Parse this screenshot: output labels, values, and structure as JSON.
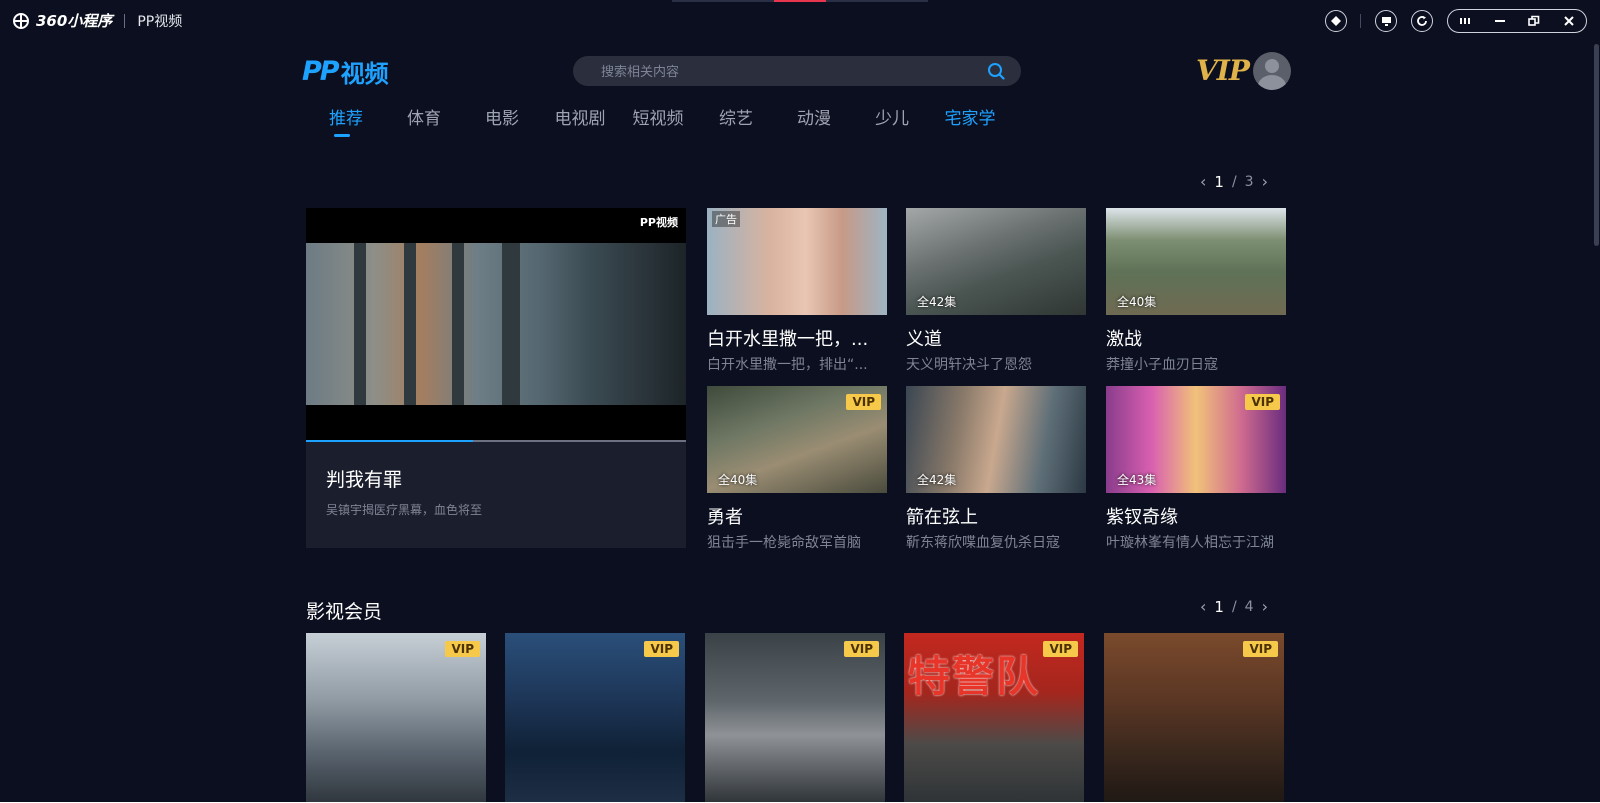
{
  "titlebar": {
    "brand": "360小程序",
    "app_name": "PP视频"
  },
  "header": {
    "logo_mark": "PP",
    "logo_text": "视频",
    "search_placeholder": "搜索相关内容",
    "vip_label": "VIP"
  },
  "nav": {
    "tabs": [
      {
        "label": "推荐"
      },
      {
        "label": "体育"
      },
      {
        "label": "电影"
      },
      {
        "label": "电视剧"
      },
      {
        "label": "短视频"
      },
      {
        "label": "综艺"
      },
      {
        "label": "动漫"
      },
      {
        "label": "少儿"
      },
      {
        "label": "宅家学"
      }
    ],
    "active_index": 0
  },
  "top_pager": {
    "current": "1",
    "separator": "/",
    "total": "3"
  },
  "featured": {
    "watermark": "PP视频",
    "title": "判我有罪",
    "desc": "吴镇宇揭医疗黑幕，血色将至",
    "progress": 0.44
  },
  "grid_cards": [
    {
      "title": "白开水里撒一把，...",
      "desc": "白开水里撒一把，排出“...",
      "badge_ad": "广告",
      "episodes": "",
      "vip": ""
    },
    {
      "title": "义道",
      "desc": "天义明轩决斗了恩怨",
      "badge_ad": "",
      "episodes": "全42集",
      "vip": ""
    },
    {
      "title": "激战",
      "desc": "莽撞小子血刃日寇",
      "badge_ad": "",
      "episodes": "全40集",
      "vip": ""
    },
    {
      "title": "勇者",
      "desc": "狙击手一枪毙命敌军首脑",
      "badge_ad": "",
      "episodes": "全40集",
      "vip": "VIP"
    },
    {
      "title": "箭在弦上",
      "desc": "靳东蒋欣喋血复仇杀日寇",
      "badge_ad": "",
      "episodes": "全42集",
      "vip": ""
    },
    {
      "title": "紫钗奇缘",
      "desc": "叶璇林峯有情人相忘于江湖",
      "badge_ad": "",
      "episodes": "全43集",
      "vip": "VIP"
    }
  ],
  "member_section": {
    "title": "影视会员",
    "pager": {
      "current": "1",
      "separator": "/",
      "total": "4"
    },
    "posters": [
      {
        "vip": "VIP"
      },
      {
        "vip": "VIP"
      },
      {
        "vip": "VIP"
      },
      {
        "vip": "VIP",
        "poster_text": "特警队"
      },
      {
        "vip": "VIP"
      }
    ]
  },
  "colors": {
    "background": "#0b0f1f",
    "accent": "#1ea2ff",
    "vip_gold": "#f6c94a",
    "panel": "#1b1e2d"
  }
}
